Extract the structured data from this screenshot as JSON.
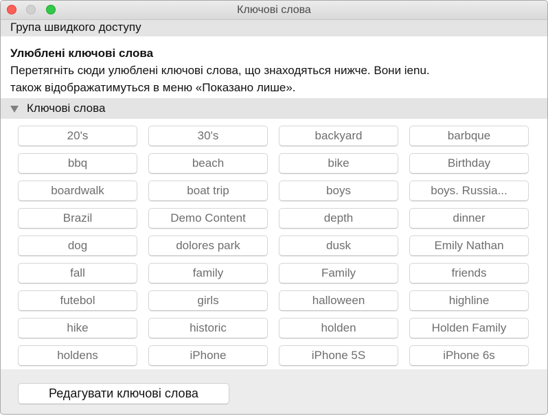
{
  "window": {
    "title": "Ключові слова"
  },
  "quick_group": {
    "label": "Група швидкого доступу"
  },
  "favorites": {
    "heading": "Улюблені ключові слова",
    "line1": "Перетягніть сюди улюблені ключові слова, що знаходяться нижче. Вони ienu.",
    "line2": "також відображатимуться в меню «Показано лише»."
  },
  "keywords_section": {
    "label": "Ключові слова",
    "expanded": true,
    "items": [
      "20's",
      "30's",
      "backyard",
      "barbque",
      "bbq",
      "beach",
      "bike",
      "Birthday",
      "boardwalk",
      "boat trip",
      "boys",
      "boys. Russia...",
      "Brazil",
      "Demo Content",
      "depth",
      "dinner",
      "dog",
      "dolores park",
      "dusk",
      "Emily Nathan",
      "fall",
      "family",
      "Family",
      "friends",
      "futebol",
      "girls",
      "halloween",
      "highline",
      "hike",
      "historic",
      "holden",
      "Holden Family",
      "holdens",
      "iPhone",
      "iPhone 5S",
      "iPhone 6s"
    ]
  },
  "footer": {
    "edit_button": "Редагувати ключові слова"
  }
}
